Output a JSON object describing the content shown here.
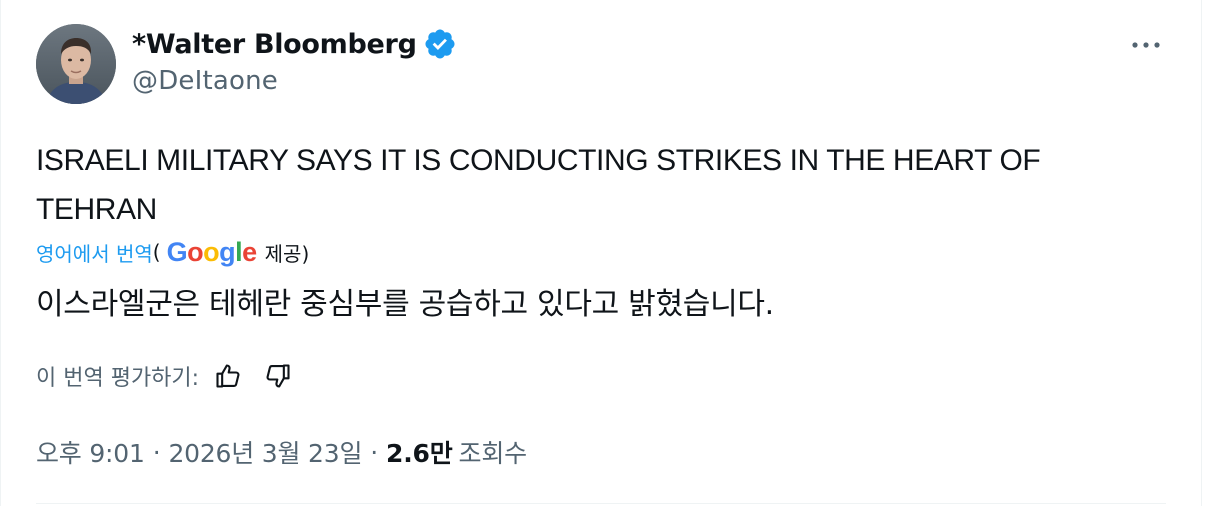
{
  "author": {
    "name": "*Walter Bloomberg",
    "handle": "@DeItaone",
    "verified": true,
    "verified_color": "#1d9bf0"
  },
  "tweet": {
    "text": "ISRAELI MILITARY SAYS IT IS CONDUCTING STRIKES IN THE HEART OF TEHRAN"
  },
  "translation": {
    "link_label": "영어에서 번역",
    "open_paren": "(",
    "provider_logo": "Google",
    "provided_by": "제공)",
    "text": "이스라엘군은 테헤란 중심부를 공습하고 있다고 밝혔습니다.",
    "rate_label": "이 번역 평가하기:",
    "thumbs_up_icon": "thumbs-up-icon",
    "thumbs_down_icon": "thumbs-down-icon"
  },
  "meta": {
    "time": "오후 9:01",
    "separator": "·",
    "date": "2026년 3월 23일",
    "views_count": "2.6만",
    "views_label": "조회수"
  },
  "icons": {
    "more": "more-horizontal-icon",
    "verified": "verified-badge-icon"
  },
  "colors": {
    "text_primary": "#0f1419",
    "text_secondary": "#536471",
    "link": "#1d9bf0",
    "google_blue": "#4285f4",
    "google_red": "#ea4335",
    "google_yellow": "#fbbc05",
    "google_green": "#34a853"
  }
}
